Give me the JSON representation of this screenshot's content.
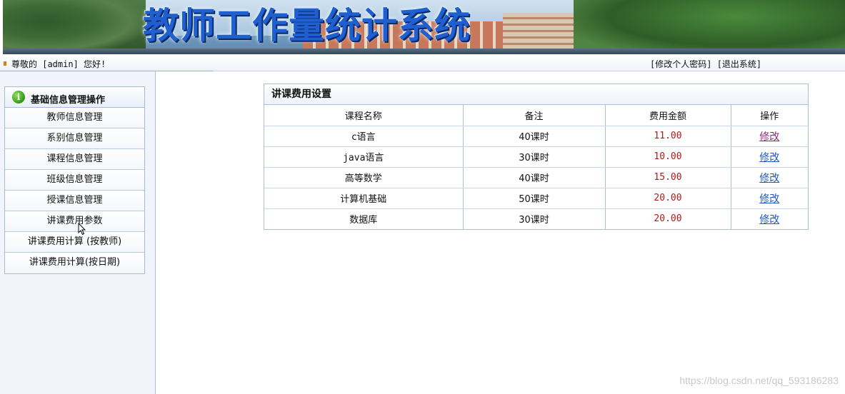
{
  "banner": {
    "title": "教师工作量统计系统"
  },
  "topbar": {
    "greeting": "尊敬的 [admin] 您好!",
    "change_password": "[修改个人密码]",
    "logout": "[退出系统]"
  },
  "sidebar": {
    "heading": "基础信息管理操作",
    "info_icon": "i",
    "items": [
      {
        "label": "教师信息管理"
      },
      {
        "label": "系别信息管理"
      },
      {
        "label": "课程信息管理"
      },
      {
        "label": "班级信息管理"
      },
      {
        "label": "授课信息管理"
      },
      {
        "label": "讲课费用参数"
      },
      {
        "label": "讲课费用计算 (按教师)"
      },
      {
        "label": "讲课费用计算(按日期)"
      }
    ]
  },
  "panel": {
    "title": "讲课费用设置",
    "columns": [
      "课程名称",
      "备注",
      "费用金额",
      "操作"
    ],
    "rows": [
      {
        "name": "c语言",
        "note": "40课时",
        "fee": "11.00",
        "action": "修改"
      },
      {
        "name": "java语言",
        "note": "30课时",
        "fee": "10.00",
        "action": "修改"
      },
      {
        "name": "高等数学",
        "note": "40课时",
        "fee": "15.00",
        "action": "修改"
      },
      {
        "name": "计算机基础",
        "note": "50课时",
        "fee": "20.00",
        "action": "修改"
      },
      {
        "name": "数据库",
        "note": "30课时",
        "fee": "20.00",
        "action": "修改"
      }
    ]
  },
  "watermark": "https://blog.csdn.net/qq_593186283",
  "colors": {
    "fee_text": "#b01a1a",
    "link": "#1f58b8",
    "visited_link": "#8a2c7c",
    "border": "#a9c0dc"
  },
  "icons": {
    "info": "info-icon",
    "cursor": "mouse-pointer-icon",
    "bullet": "bullet-icon"
  }
}
